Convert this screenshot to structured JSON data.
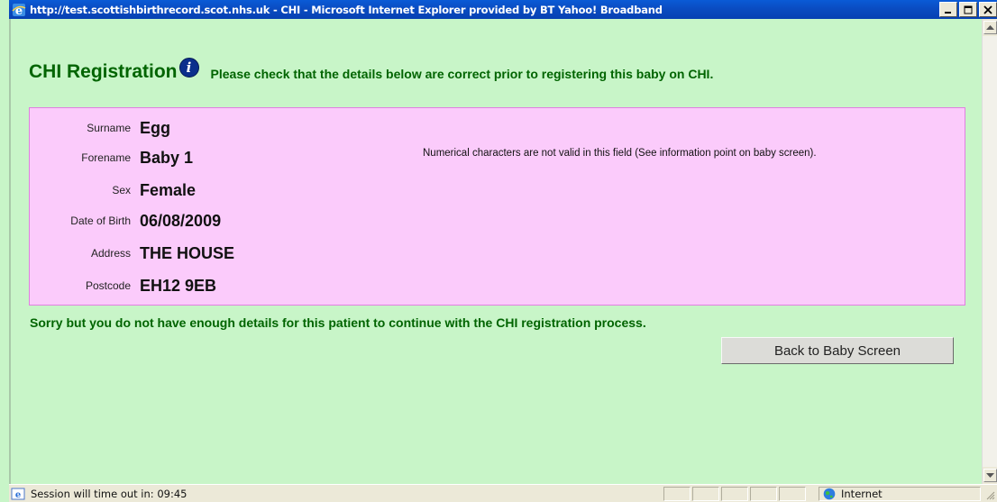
{
  "window": {
    "title": "http://test.scottishbirthrecord.scot.nhs.uk - CHI - Microsoft Internet Explorer provided by BT Yahoo! Broadband",
    "controls": [
      "minimize",
      "maximize",
      "close"
    ]
  },
  "page": {
    "heading": "CHI Registration",
    "instruction": "Please check that the details below are correct prior to registering this baby on CHI.",
    "details": [
      {
        "label": "Surname",
        "value": "Egg"
      },
      {
        "label": "Forename",
        "value": "Baby 1"
      },
      {
        "label": "Sex",
        "value": "Female"
      },
      {
        "label": "Date of Birth",
        "value": "06/08/2009"
      },
      {
        "label": "Address",
        "value": "THE HOUSE"
      },
      {
        "label": "Postcode",
        "value": "EH12 9EB"
      }
    ],
    "forename_note": "Numerical characters are not valid in this field (See information point on baby screen).",
    "error_message": "Sorry but you do not have enough details for this patient to continue with the CHI registration process.",
    "back_button": "Back to Baby Screen"
  },
  "statusbar": {
    "session_text": "Session will time out in:  09:45",
    "zone": "Internet"
  },
  "colors": {
    "background": "#c8f5c8",
    "heading": "#006400",
    "details_box": "#fbcbfb",
    "titlebar": "#0a4cc2"
  }
}
